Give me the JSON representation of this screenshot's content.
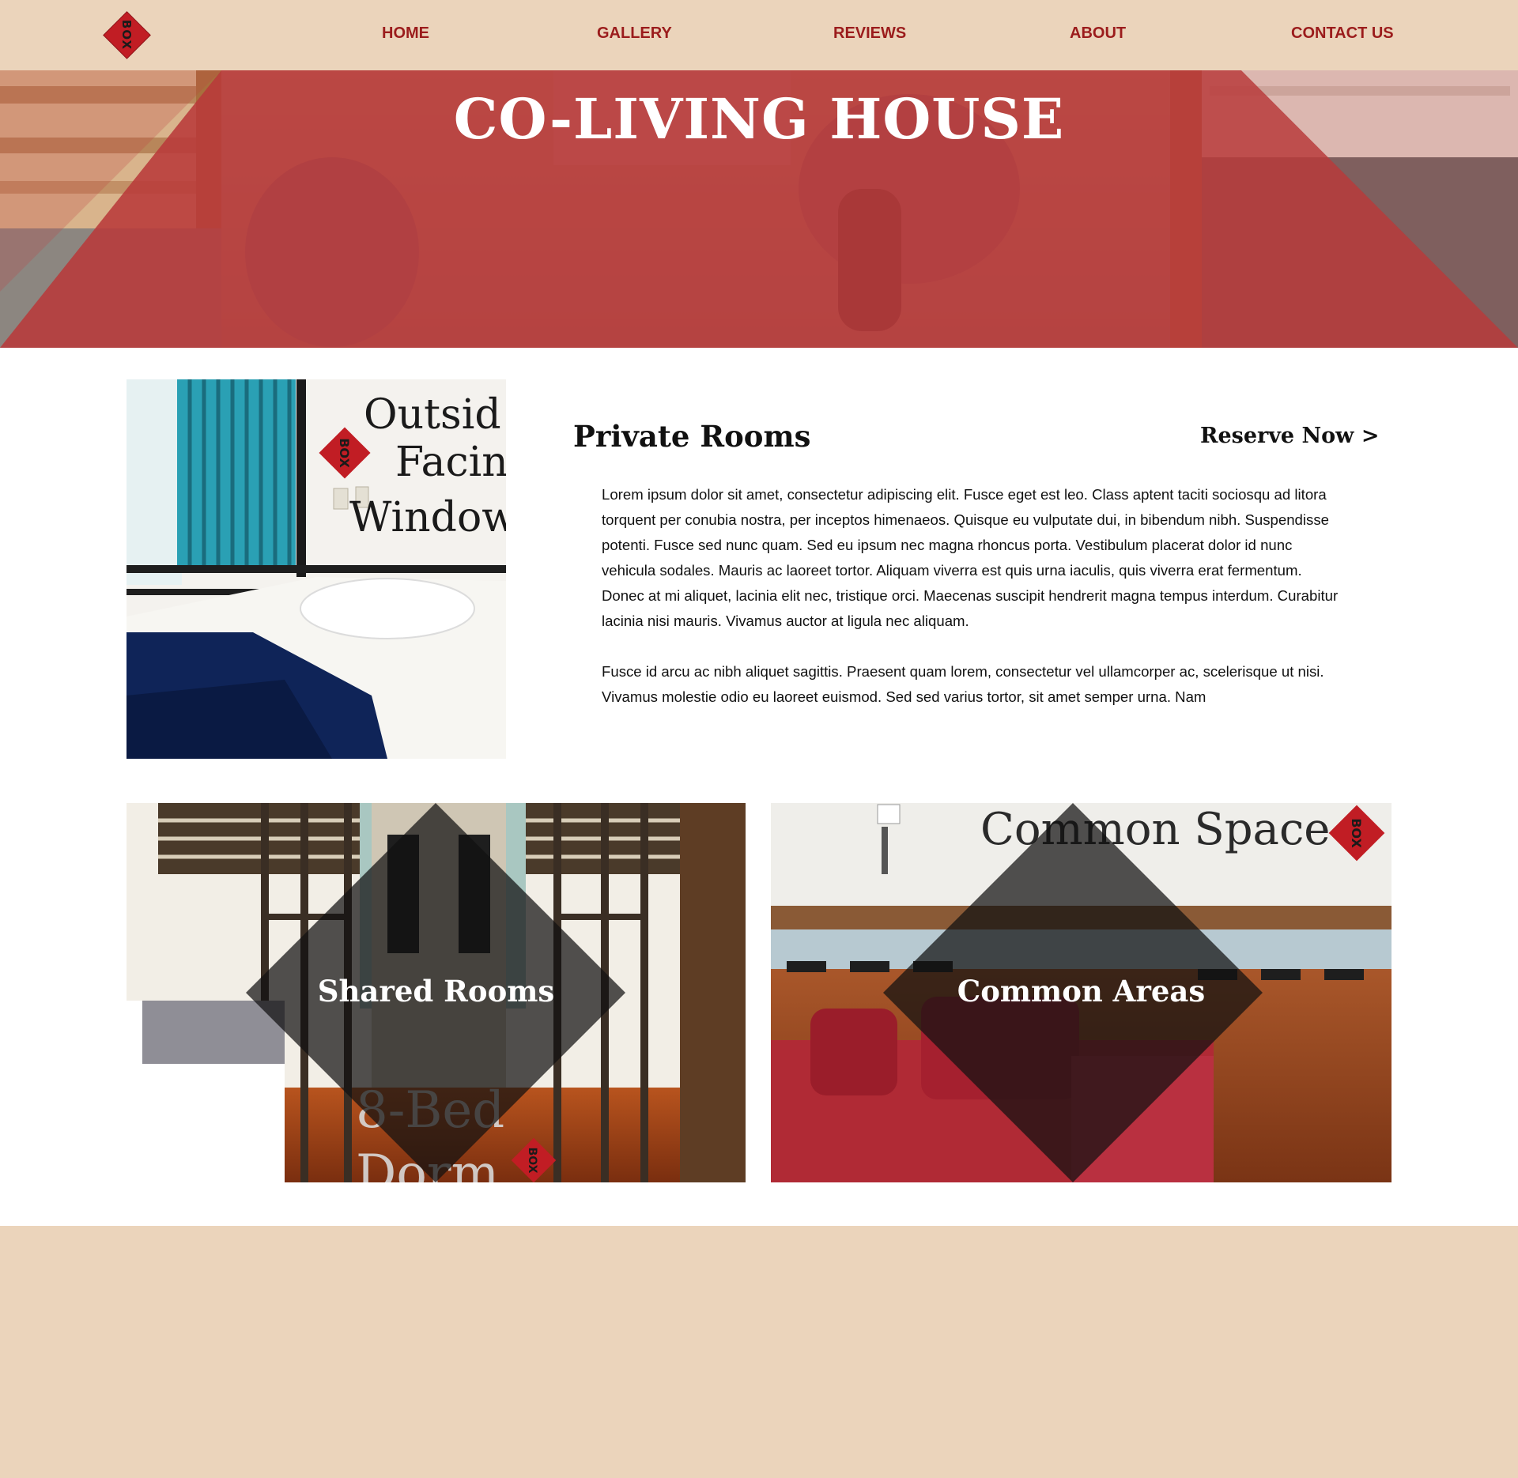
{
  "nav": {
    "logo_text": "BOX",
    "links": [
      "HOME",
      "GALLERY",
      "REVIEWS",
      "ABOUT",
      "CONTACT US"
    ]
  },
  "hero": {
    "title": "CO-LIVING HOUSE"
  },
  "private_rooms": {
    "title": "Private Rooms",
    "reserve_label": "Reserve Now >",
    "photo_sign_lines": [
      "Outsid",
      "Facin",
      "Window"
    ],
    "photo_logo_text": "BOX",
    "paragraphs": [
      "Lorem ipsum dolor sit amet, consectetur adipiscing elit. Fusce eget est leo. Class aptent taciti sociosqu ad litora torquent per conubia nostra, per inceptos himenaeos. Quisque eu vulputate dui, in bibendum nibh. Suspendisse potenti. Fusce sed nunc quam. Sed eu ipsum nec magna rhoncus porta. Vestibulum placerat dolor id nunc vehicula sodales. Mauris ac laoreet tortor. Aliquam viverra est quis urna iaculis, quis viverra erat fermentum. Donec at mi aliquet, lacinia elit nec, tristique orci. Maecenas suscipit hendrerit magna tempus interdum. Curabitur lacinia nisi mauris. Vivamus auctor at ligula nec aliquam.",
      "Fusce id arcu ac nibh aliquet sagittis. Praesent quam lorem, consectetur vel ullamcorper ac, scelerisque ut nisi. Vivamus molestie odio eu laoreet euismod. Sed sed varius tortor, sit amet semper urna. Nam"
    ]
  },
  "tiles": {
    "shared": {
      "label": "Shared Rooms",
      "sign_lines": [
        "8-Bed",
        "Dorm"
      ],
      "logo_text": "BOX"
    },
    "common": {
      "label": "Common Areas",
      "sign_text": "Common Space",
      "logo_text": "BOX"
    }
  },
  "colors": {
    "nav_bg": "#ebd4bb",
    "nav_link": "#9b1c1c",
    "brand_red": "#c11d24",
    "hero_overlay": "#b83a3a",
    "footer_bg": "#ebd4bb"
  }
}
